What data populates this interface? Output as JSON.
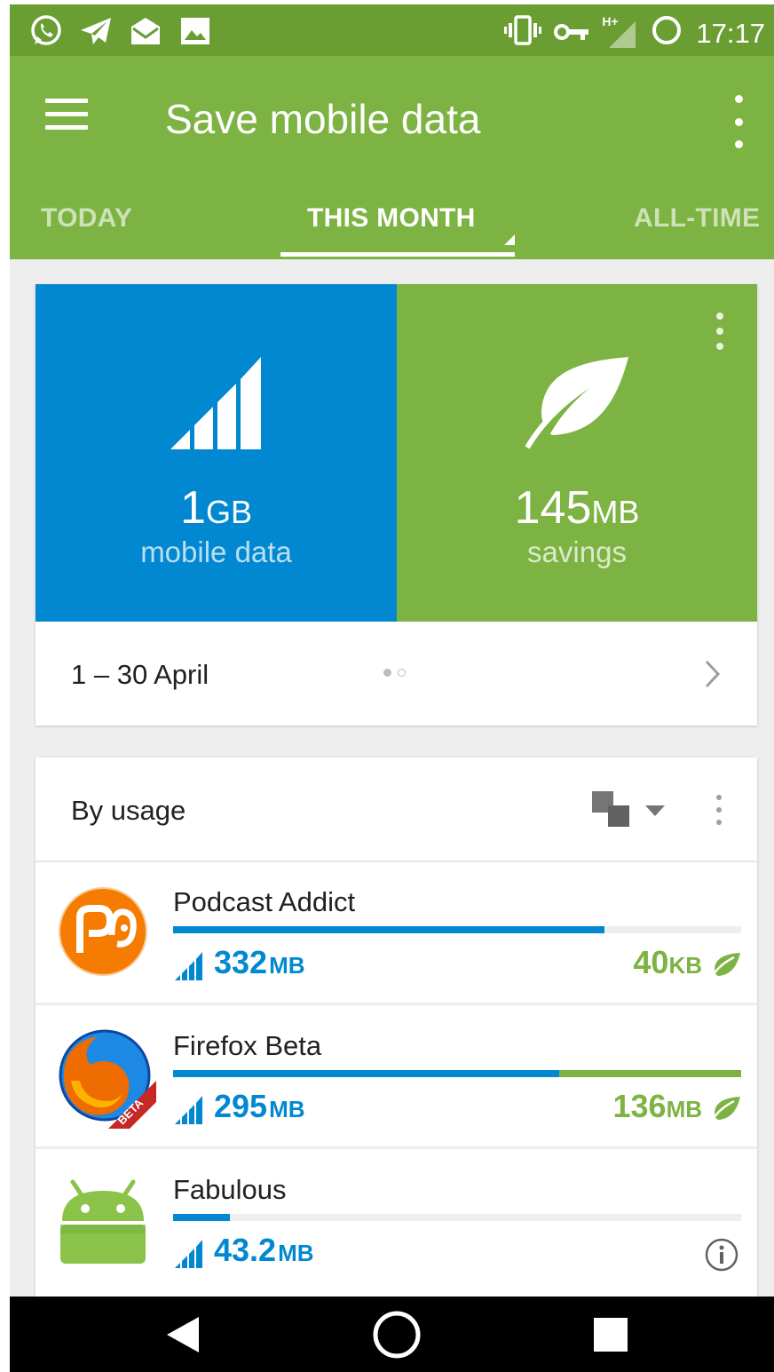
{
  "status_bar": {
    "time": "17:17",
    "left_icons": [
      "whatsapp-icon",
      "telegram-icon",
      "mail-icon",
      "image-icon"
    ],
    "right_icons": [
      "vibrate-icon",
      "vpn-key-icon",
      "signal-hplus-icon",
      "battery-charging-icon"
    ],
    "network_label": "H+"
  },
  "app_bar": {
    "title": "Save mobile data",
    "tabs": [
      {
        "label": "TODAY",
        "active": false
      },
      {
        "label": "THIS MONTH",
        "active": true
      },
      {
        "label": "ALL-TIME",
        "active": false
      }
    ]
  },
  "summary": {
    "mobile_data": {
      "value": "1",
      "unit": "GB",
      "label": "mobile data",
      "color": "#0288d1",
      "icon": "signal-bars-icon"
    },
    "savings": {
      "value": "145",
      "unit": "MB",
      "label": "savings",
      "color": "#7cb342",
      "icon": "leaf-icon"
    },
    "period": "1 – 30 April",
    "page_index": 1,
    "page_count": 2
  },
  "usage": {
    "title": "By usage",
    "apps": [
      {
        "name": "Podcast Addict",
        "used_value": "332",
        "used_unit": "MB",
        "saved_value": "40",
        "saved_unit": "KB",
        "used_fraction": 0.76,
        "saved_fraction": 0.0,
        "icon": "podcast-addict-icon"
      },
      {
        "name": "Firefox Beta",
        "used_value": "295",
        "used_unit": "MB",
        "saved_value": "136",
        "saved_unit": "MB",
        "used_fraction": 0.68,
        "saved_fraction": 0.32,
        "icon": "firefox-beta-icon",
        "icon_badge": "BETA"
      },
      {
        "name": "Fabulous",
        "used_value": "43.2",
        "used_unit": "MB",
        "saved_value": "",
        "saved_unit": "",
        "used_fraction": 0.1,
        "saved_fraction": 0.0,
        "icon": "android-icon"
      }
    ]
  },
  "colors": {
    "status_bar": "#6a9e33",
    "app_bar": "#7cb342",
    "blue": "#0288d1",
    "green": "#7cb342"
  }
}
